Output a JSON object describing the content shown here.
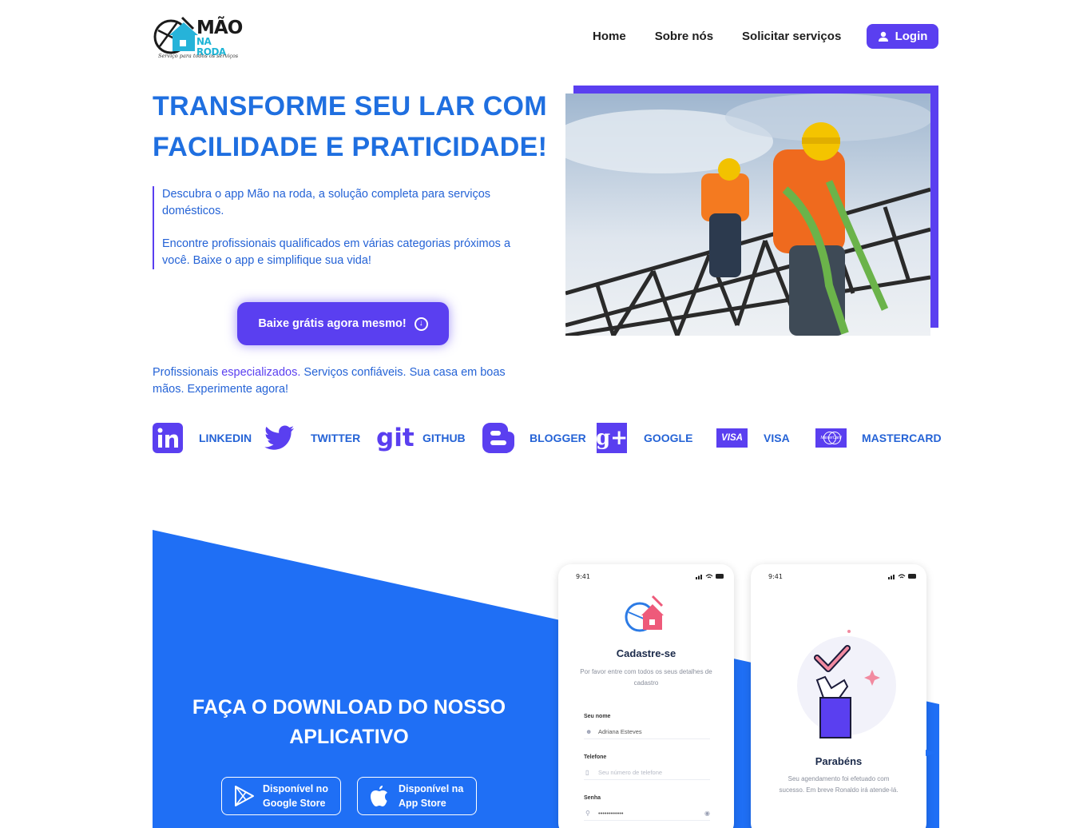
{
  "header": {
    "logo": {
      "title": "MÃO",
      "subtitle": "NA RODA",
      "tagline": "Serviço para todos os serviços"
    },
    "nav": [
      "Home",
      "Sobre nós",
      "Solicitar serviços"
    ],
    "login_label": "Login"
  },
  "hero": {
    "title": "TRANSFORME SEU LAR COM FACILIDADE E PRATICIDADE!",
    "paragraph_1": "Descubra o app Mão na roda, a solução completa para serviços domésticos.",
    "paragraph_2": "Encontre profissionais qualificados em várias categorias próximos a você. Baixe o app e simplifique sua vida!",
    "cta_label": "Baixe grátis agora mesmo!",
    "tagline_start": "Profissionais ",
    "tagline_em": "especializados.",
    "tagline_end": " Serviços confiáveis. Sua casa em boas mãos. Experimente agora!"
  },
  "social": [
    {
      "icon": "linkedin-icon",
      "label": "LINKEDIN"
    },
    {
      "icon": "twitter-icon",
      "label": "TWITTER"
    },
    {
      "icon": "github-icon",
      "icon_text": "git",
      "label": "GITHUB"
    },
    {
      "icon": "blogger-icon",
      "label": "BLOGGER"
    },
    {
      "icon": "google-plus-icon",
      "icon_text": "g+",
      "label": "GOOGLE"
    },
    {
      "icon": "visa-icon",
      "icon_text": "VISA",
      "label": "VISA"
    },
    {
      "icon": "mastercard-icon",
      "icon_text": "MasterCard",
      "label": "MASTERCARD"
    }
  ],
  "download": {
    "title": "FAÇA O DOWNLOAD DO NOSSO APLICATIVO",
    "google": {
      "line1": "Disponível no",
      "line2": "Google Store"
    },
    "apple": {
      "line1": "Disponível na",
      "line2": "App Store"
    }
  },
  "phone_signup": {
    "time": "9:41",
    "title": "Cadastre-se",
    "subtitle": "Por favor entre com todos os seus detalhes de cadastro",
    "name_label": "Seu nome",
    "name_value": "Adriana Esteves",
    "phone_label": "Telefone",
    "phone_placeholder": "Seu número de telefone",
    "password_label": "Senha",
    "password_value": "••••••••••••"
  },
  "phone_success": {
    "time": "9:41",
    "title": "Parabéns",
    "message": "Seu agendamento foi efetuado com sucesso. Em breve Ronaldo irá atende-lá."
  },
  "colors": {
    "primary_blue": "#1f6fe0",
    "purple": "#5a3ff0",
    "section_blue": "#1f6ff5"
  }
}
